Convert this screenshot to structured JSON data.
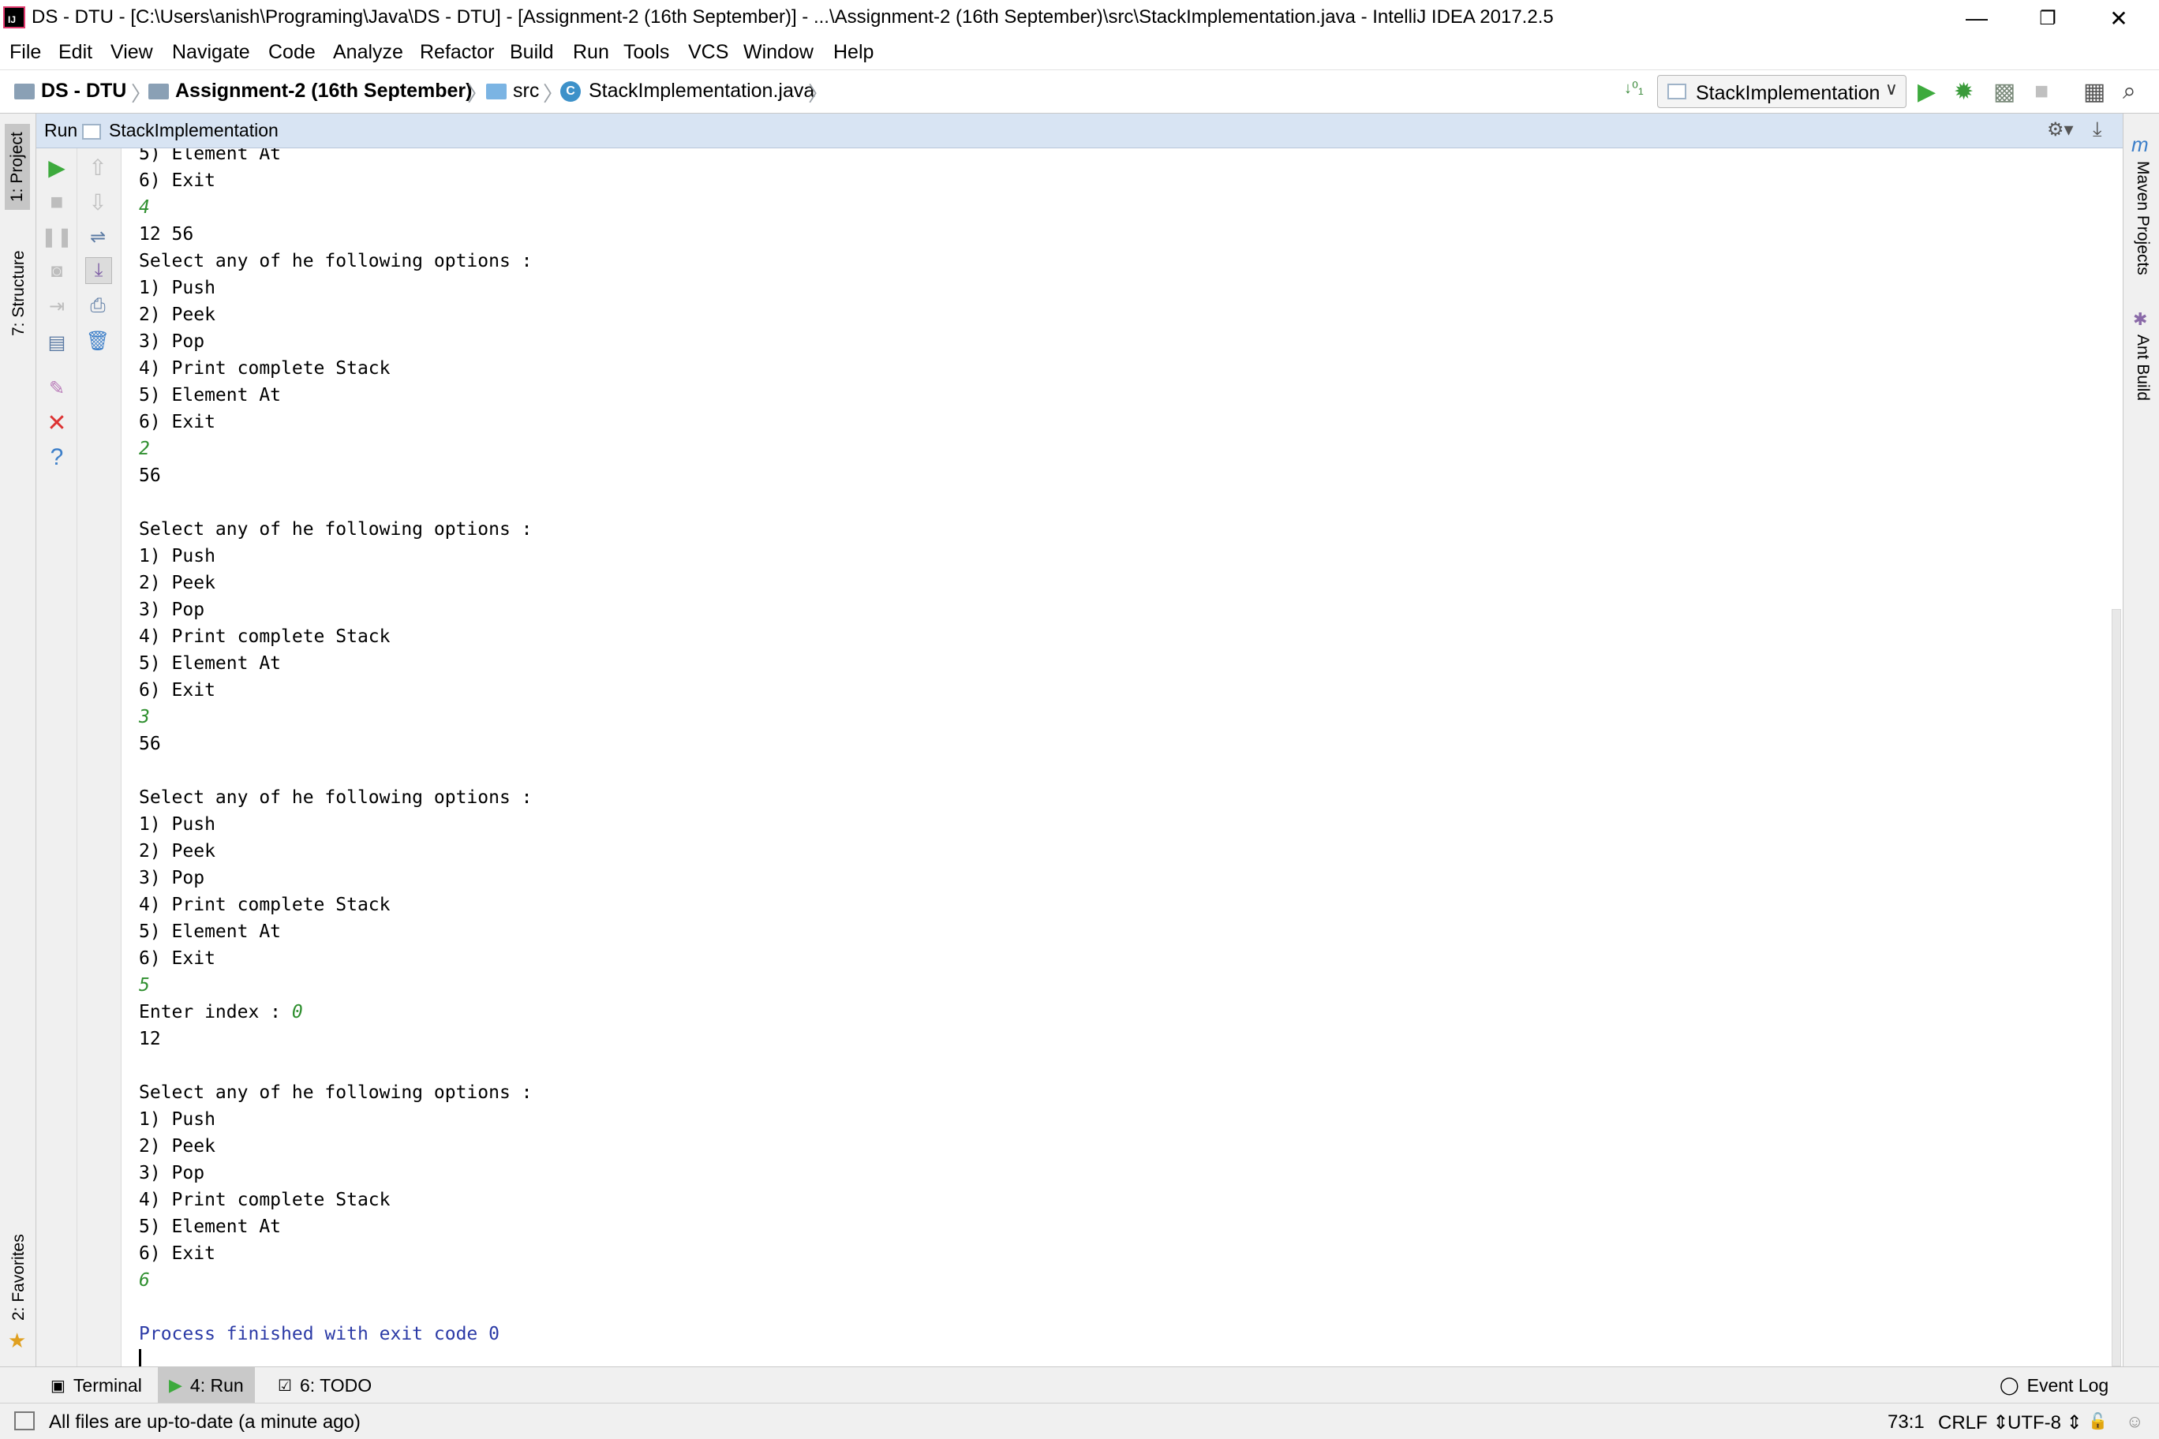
{
  "window": {
    "title": "DS - DTU - [C:\\Users\\anish\\Programing\\Java\\DS - DTU] - [Assignment-2 (16th September)] - ...\\Assignment-2 (16th September)\\src\\StackImplementation.java - IntelliJ IDEA 2017.2.5",
    "app_icon_letter": "IJ",
    "minimize": "—",
    "restore": "❐",
    "close": "✕"
  },
  "menu": [
    "File",
    "Edit",
    "View",
    "Navigate",
    "Code",
    "Analyze",
    "Refactor",
    "Build",
    "Run",
    "Tools",
    "VCS",
    "Window",
    "Help"
  ],
  "breadcrumb": {
    "project": "DS - DTU",
    "module": "Assignment-2 (16th September)",
    "folder": "src",
    "file": "StackImplementation.java"
  },
  "run_config": {
    "name": "StackImplementation",
    "dropdown": "∨"
  },
  "toolbar_glyphs": {
    "sort": "↓⁰₁",
    "run": "▶",
    "debug": "✹",
    "coverage": "▩",
    "stop": "■",
    "structure": "▦",
    "search": "⌕"
  },
  "left_tabs": {
    "project": "1: Project",
    "structure": "7: Structure",
    "favorites": "2: Favorites"
  },
  "right_tabs": {
    "maven": "Maven Projects",
    "ant": "Ant Build"
  },
  "run_panel": {
    "label": "Run",
    "tab": "StackImplementation",
    "settings": "⚙▾",
    "pin": "⤓"
  },
  "console": {
    "lines": [
      {
        "t": "5) Element At",
        "k": "out"
      },
      {
        "t": "6) Exit",
        "k": "out"
      },
      {
        "t": "4",
        "k": "in"
      },
      {
        "t": "12 56",
        "k": "out"
      },
      {
        "t": "Select any of he following options :",
        "k": "out"
      },
      {
        "t": "1) Push",
        "k": "out"
      },
      {
        "t": "2) Peek",
        "k": "out"
      },
      {
        "t": "3) Pop",
        "k": "out"
      },
      {
        "t": "4) Print complete Stack",
        "k": "out"
      },
      {
        "t": "5) Element At",
        "k": "out"
      },
      {
        "t": "6) Exit",
        "k": "out"
      },
      {
        "t": "2",
        "k": "in"
      },
      {
        "t": "56",
        "k": "out"
      },
      {
        "t": "",
        "k": "out"
      },
      {
        "t": "Select any of he following options :",
        "k": "out"
      },
      {
        "t": "1) Push",
        "k": "out"
      },
      {
        "t": "2) Peek",
        "k": "out"
      },
      {
        "t": "3) Pop",
        "k": "out"
      },
      {
        "t": "4) Print complete Stack",
        "k": "out"
      },
      {
        "t": "5) Element At",
        "k": "out"
      },
      {
        "t": "6) Exit",
        "k": "out"
      },
      {
        "t": "3",
        "k": "in"
      },
      {
        "t": "56",
        "k": "out"
      },
      {
        "t": "",
        "k": "out"
      },
      {
        "t": "Select any of he following options :",
        "k": "out"
      },
      {
        "t": "1) Push",
        "k": "out"
      },
      {
        "t": "2) Peek",
        "k": "out"
      },
      {
        "t": "3) Pop",
        "k": "out"
      },
      {
        "t": "4) Print complete Stack",
        "k": "out"
      },
      {
        "t": "5) Element At",
        "k": "out"
      },
      {
        "t": "6) Exit",
        "k": "out"
      },
      {
        "t": "5",
        "k": "in"
      },
      {
        "t": "Enter index : ",
        "k": "out",
        "input": "0"
      },
      {
        "t": "12",
        "k": "out"
      },
      {
        "t": "",
        "k": "out"
      },
      {
        "t": "Select any of he following options :",
        "k": "out"
      },
      {
        "t": "1) Push",
        "k": "out"
      },
      {
        "t": "2) Peek",
        "k": "out"
      },
      {
        "t": "3) Pop",
        "k": "out"
      },
      {
        "t": "4) Print complete Stack",
        "k": "out"
      },
      {
        "t": "5) Element At",
        "k": "out"
      },
      {
        "t": "6) Exit",
        "k": "out"
      },
      {
        "t": "6",
        "k": "in"
      },
      {
        "t": "",
        "k": "out"
      },
      {
        "t": "Process finished with exit code 0",
        "k": "sys"
      }
    ],
    "colors": {
      "input": "#2f8f2f",
      "system": "#2b3aa6"
    }
  },
  "bottom_tabs": {
    "terminal": "Terminal",
    "run": "4: Run",
    "todo": "6: TODO",
    "event_log": "Event Log"
  },
  "status": {
    "message": "All files are up-to-date (a minute ago)",
    "position": "73:1",
    "line_sep": "CRLF ⇕",
    "encoding": "UTF-8 ⇕"
  },
  "colors": {
    "run_green": "#3daa3d",
    "debug_green": "#3b9b3b",
    "header_blue": "#d8e4f3"
  }
}
